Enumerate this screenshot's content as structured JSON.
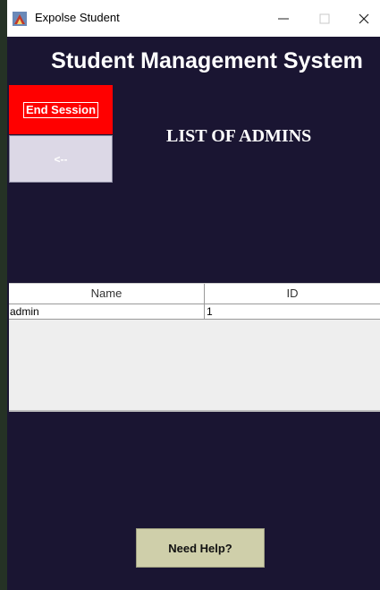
{
  "window": {
    "title": "Expolse Student",
    "minimize_icon": "minimize-icon",
    "maximize_icon": "maximize-icon",
    "close_icon": "close-icon"
  },
  "app": {
    "title": "Student Management System",
    "background": "#1a1532"
  },
  "sidebar": {
    "end_session_label": "End Session",
    "back_label": "<--"
  },
  "section": {
    "title": "LIST OF ADMINS"
  },
  "table": {
    "columns": [
      "Name",
      "ID"
    ],
    "rows": [
      {
        "name": "admin",
        "id": "1"
      }
    ]
  },
  "footer": {
    "help_label": "Need Help?"
  },
  "colors": {
    "end_session": "#ff0000",
    "help_button": "#cfcfaa"
  }
}
